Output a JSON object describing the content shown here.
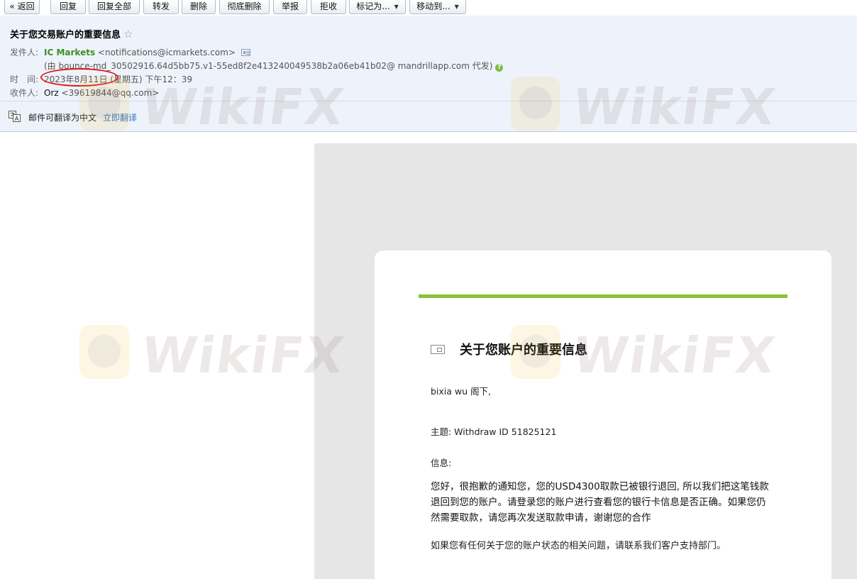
{
  "toolbar": {
    "back": "« 返回",
    "reply": "回复",
    "reply_all": "回复全部",
    "forward": "转发",
    "delete": "删除",
    "delete_forever": "彻底删除",
    "report": "举报",
    "reject": "拒收",
    "mark_as": "标记为...",
    "move_to": "移动到..."
  },
  "header": {
    "subject": "关于您交易账户的重要信息",
    "star": "☆",
    "from_label": "发件人:",
    "sender_name": "IC Markets",
    "sender_email": "<notifications@icmarkets.com>",
    "via_line": "(由 bounce-md_30502916.64d5bb75.v1-55ed8f2e413240049538b2a06eb41b02@ mandrillapp.com 代发)",
    "time_label": "时　间:",
    "date": "2023年8月11日",
    "weekday_time": "(星期五) 下午12：39",
    "to_label": "收件人:",
    "recipient_name": "Orz",
    "recipient_email": "<39619844@qq.com>",
    "translate_text": "邮件可翻译为中文",
    "translate_link": "立即翻译"
  },
  "email": {
    "title": "关于您账户的重要信息",
    "greeting": "bixia wu 阁下,",
    "subject_line": "主题: Withdraw ID 51825121",
    "info_label": "信息:",
    "message": "您好，很抱歉的通知您，您的USD4300取款已被银行退回, 所以我们把这笔钱款退回到您的账户。请登录您的账户进行查看您的银行卡信息是否正确。如果您仍然需要取款，请您再次发送取款申请，谢谢您的合作",
    "footer_note": "如果您有任何关于您的账户状态的相关问题，请联系我们客户支持部门。"
  },
  "watermark": {
    "text": "WikiFX",
    "logo_color": "#f4c33c"
  },
  "colors": {
    "sender_green": "#3f8e24",
    "accent_bar": "#8cc03a",
    "link_blue": "#2f6fbf",
    "circle_red": "#e01717"
  }
}
